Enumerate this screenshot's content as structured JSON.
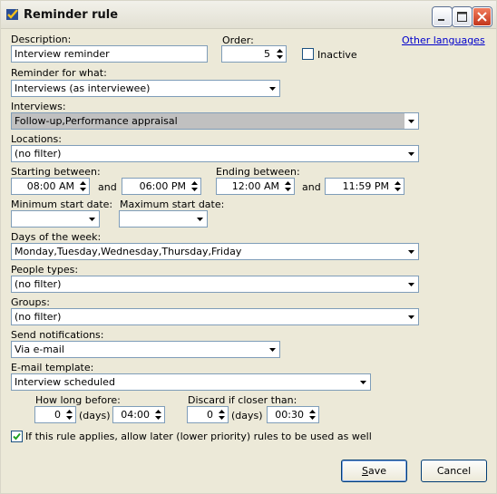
{
  "window": {
    "title": "Reminder rule"
  },
  "labels": {
    "description": "Description:",
    "order": "Order:",
    "inactive": "Inactive",
    "other_languages": "Other languages",
    "reminder_for_what": "Reminder for what:",
    "interviews": "Interviews:",
    "locations": "Locations:",
    "starting_between": "Starting between:",
    "ending_between": "Ending between:",
    "and": "and",
    "min_start_date": "Minimum start date:",
    "max_start_date": "Maximum start date:",
    "days_of_week": "Days of the week:",
    "people_types": "People types:",
    "groups": "Groups:",
    "send_notifications": "Send notifications:",
    "email_template": "E-mail template:",
    "how_long_before": "How long before:",
    "discard_if_closer": "Discard if closer than:",
    "days_unit": "(days)",
    "allow_later_rules": "If this rule applies, allow later (lower priority) rules to be used as well"
  },
  "values": {
    "description": "Interview reminder",
    "order": "5",
    "inactive_checked": false,
    "reminder_for_what": "Interviews (as interviewee)",
    "interviews": "Follow-up,Performance appraisal",
    "locations": "(no filter)",
    "start_from": "08:00 AM",
    "start_to": "06:00 PM",
    "end_from": "12:00 AM",
    "end_to": "11:59 PM",
    "min_start_date": "",
    "max_start_date": "",
    "days_of_week": "Monday,Tuesday,Wednesday,Thursday,Friday",
    "people_types": "(no filter)",
    "groups": "(no filter)",
    "send_notifications": "Via e-mail",
    "email_template": "Interview scheduled",
    "before_days": "0",
    "before_time": "04:00",
    "discard_days": "0",
    "discard_time": "00:30",
    "allow_later_checked": true
  },
  "buttons": {
    "save_u": "S",
    "save_rest": "ave",
    "cancel": "Cancel"
  },
  "icons": {
    "app": "reminder-check-icon",
    "minimize": "minimize-icon",
    "maximize": "maximize-icon",
    "close": "close-icon"
  }
}
